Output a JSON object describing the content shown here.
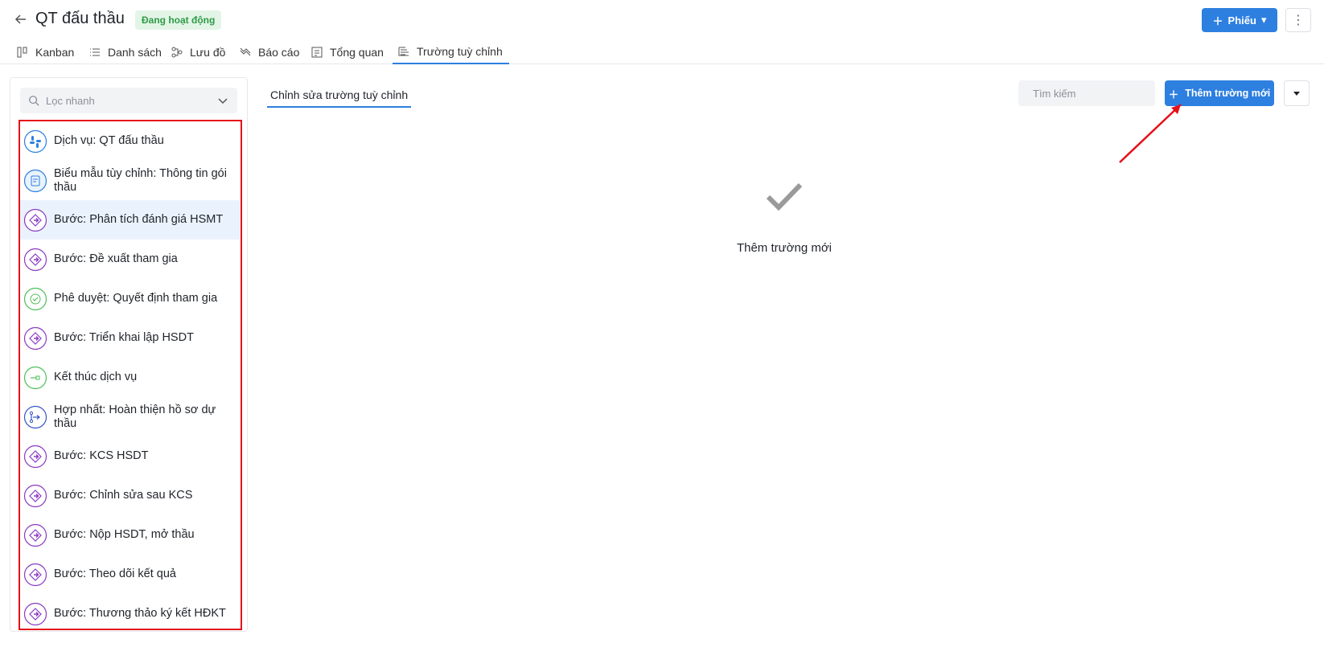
{
  "header": {
    "title": "QT đấu thầu",
    "status": "Đang hoạt động",
    "new_ticket_label": "Phiếu",
    "colors": {
      "accent": "#2d7fe0",
      "status_bg": "#e3f5e6",
      "status_fg": "#2e9b47"
    }
  },
  "tabs": [
    {
      "label": "Kanban",
      "icon": "kanban-icon"
    },
    {
      "label": "Danh sách",
      "icon": "list-icon"
    },
    {
      "label": "Lưu đồ",
      "icon": "flowchart-icon"
    },
    {
      "label": "Báo cáo",
      "icon": "chart-icon"
    },
    {
      "label": "Tổng quan",
      "icon": "overview-icon"
    },
    {
      "label": "Trường tuỳ chỉnh",
      "icon": "custom-fields-icon",
      "active": true
    }
  ],
  "sidebar": {
    "filter_placeholder": "Lọc nhanh",
    "items": [
      {
        "label": "Dịch vụ: QT đấu thầu",
        "icon": "service-icon"
      },
      {
        "label": "Biểu mẫu tùy chỉnh: Thông tin gói thầu",
        "icon": "form-icon"
      },
      {
        "label": "Bước: Phân tích đánh giá HSMT",
        "icon": "step-icon",
        "selected": true
      },
      {
        "label": "Bước: Đề xuất tham gia",
        "icon": "step-icon"
      },
      {
        "label": "Phê duyệt: Quyết định tham gia",
        "icon": "approval-icon"
      },
      {
        "label": "Bước: Triển khai lập HSDT",
        "icon": "step-icon"
      },
      {
        "label": "Kết thúc dịch vụ",
        "icon": "end-icon"
      },
      {
        "label": "Hợp nhất: Hoàn thiện hồ sơ dự thầu",
        "icon": "merge-icon"
      },
      {
        "label": "Bước: KCS HSDT",
        "icon": "step-icon"
      },
      {
        "label": "Bước: Chỉnh sửa sau KCS",
        "icon": "step-icon"
      },
      {
        "label": "Bước: Nộp HSDT, mở thầu",
        "icon": "step-icon"
      },
      {
        "label": "Bước: Theo dõi kết quả",
        "icon": "step-icon"
      },
      {
        "label": "Bước: Thương thảo ký kết HĐKT",
        "icon": "step-icon"
      }
    ]
  },
  "main": {
    "edit_tab_label": "Chỉnh sửa trường tuỳ chỉnh",
    "search_placeholder": "Tìm kiếm",
    "add_button_label": "Thêm trường mới",
    "empty_text": "Thêm trường mới"
  }
}
